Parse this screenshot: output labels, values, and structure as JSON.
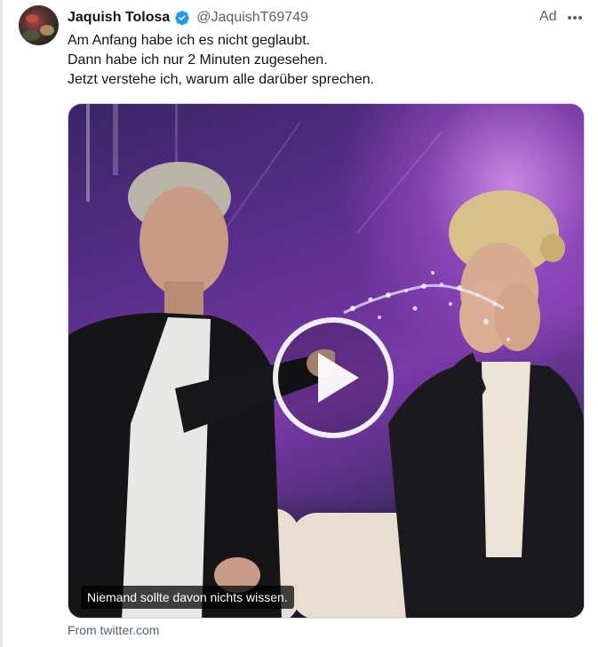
{
  "tweet": {
    "display_name": "Jaquish Tolosa",
    "handle": "@JaquishT69749",
    "verified_icon": "verified-badge-icon",
    "ad_label": "Ad",
    "more_icon": "more-icon",
    "text_lines": [
      "Am Anfang habe ich es nicht geglaubt.",
      "Dann habe ich nur 2 Minuten zugesehen.",
      "Jetzt verstehe ich, warum alle darüber sprechen."
    ],
    "media": {
      "caption": "Niemand sollte davon nichts wissen.",
      "play_icon": "play-icon"
    },
    "source_label": "From twitter.com"
  },
  "colors": {
    "text_primary": "#0f1419",
    "text_secondary": "#536471",
    "verified_blue": "#1d9bf0",
    "border": "#cfd9de"
  }
}
